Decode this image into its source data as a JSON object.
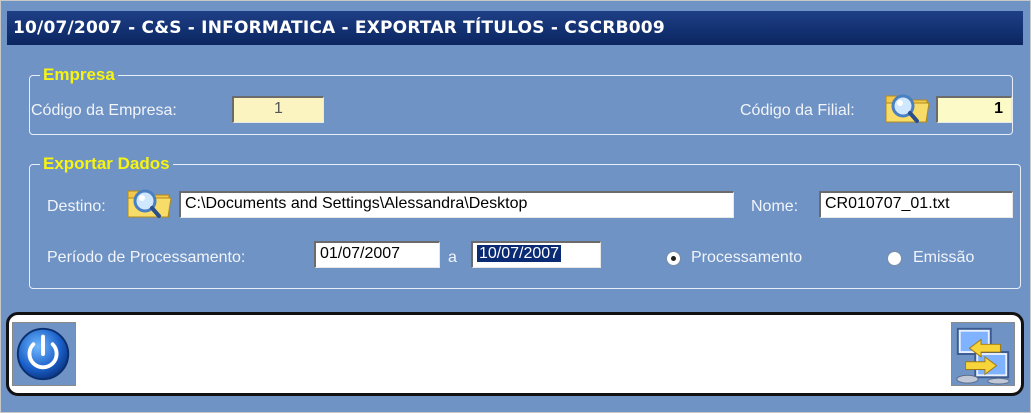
{
  "window": {
    "title": "10/07/2007 - C&S - INFORMATICA - EXPORTAR TÍTULOS - CSCRB009"
  },
  "empresa": {
    "legend": "Empresa",
    "codigo_empresa_label": "Código da Empresa:",
    "codigo_empresa_value": "1",
    "codigo_filial_label": "Código da Filial:",
    "codigo_filial_value": "1"
  },
  "exportar": {
    "legend": "Exportar Dados",
    "destino_label": "Destino:",
    "destino_value": "C:\\Documents and Settings\\Alessandra\\Desktop",
    "nome_label": "Nome:",
    "nome_value": "CR010707_01.txt",
    "periodo_label": "Período de Processamento:",
    "periodo_inicio": "01/07/2007",
    "periodo_sep": "a",
    "periodo_fim": "10/07/2007",
    "opcoes": [
      {
        "label": "Processamento",
        "checked": true
      },
      {
        "label": "Emissão",
        "checked": false
      }
    ]
  },
  "colors": {
    "window_bg": "#6f93c4",
    "title_bg": "#123070",
    "legend_text": "#f7f312"
  },
  "icons": {
    "search_folder": "folder-search-icon",
    "exit": "power-icon",
    "export": "export-transfer-icon"
  }
}
